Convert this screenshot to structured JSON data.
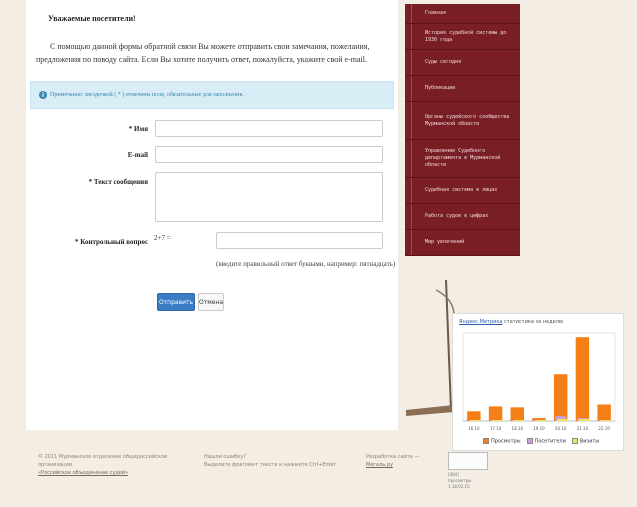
{
  "form": {
    "greeting": "Уважаемые посетители!",
    "intro": "С помощью данной формы обратной связи Вы можете отправить свои замечания, пожелания, предложения по поводу сайта. Если Вы хотите получить ответ, пожалуйста, укажите свой e-mail.",
    "note": "Примечание: звездочкой ( * ) отмечены поля, обязательные для заполнения.",
    "name_label": "* Имя",
    "email_label": "E-mail",
    "message_label": "* Текст сообщения",
    "captcha_label": "* Контрольный вопрос",
    "captcha_question": "2+7 =",
    "captcha_hint": "(введите правильный ответ буквами, например: пятнадцать)",
    "submit_label": "Отправить",
    "cancel_label": "Отмена"
  },
  "nav": {
    "items": [
      {
        "label": "Главная"
      },
      {
        "label": "История судебной системы до 1930 года"
      },
      {
        "label": "Суды сегодня"
      },
      {
        "label": "Публикации"
      },
      {
        "label": "Органы судейского сообщества Мурманской области"
      },
      {
        "label": "Управление Судебного департамента в Мурманской области"
      },
      {
        "label": "Судебная система в лицах"
      },
      {
        "label": "Работа судов в цифрах"
      },
      {
        "label": "Мир увлечений"
      }
    ]
  },
  "metrika": {
    "brand": "Яндекс.Метрика",
    "title_rest": "статистика за неделю",
    "legend": [
      "Просмотры",
      "Посетители",
      "Визиты"
    ]
  },
  "chart_data": {
    "type": "bar",
    "categories": [
      "16.10",
      "17.10",
      "18.10",
      "19.10",
      "20.10",
      "21.10",
      "22.10"
    ],
    "series": [
      {
        "name": "Просмотры",
        "values": [
          10,
          15,
          14,
          3,
          48,
          86,
          17
        ]
      },
      {
        "name": "Посетители",
        "values": [
          1,
          1,
          1,
          1,
          5,
          3,
          1
        ]
      },
      {
        "name": "Визиты",
        "values": [
          1,
          1,
          1,
          1,
          2,
          2,
          1
        ]
      }
    ],
    "colors": {
      "Просмотры": "#f57f17",
      "Посетители": "#c9a0dc",
      "Визиты": "#f2e45c"
    },
    "legend": "bottom"
  },
  "footer": {
    "col1_line1": "© 2011 Мурманское отделение общероссийской организации",
    "col1_link": "«Российское объединение судей»",
    "col2_line1": "Нашли ошибку?",
    "col2_line2": "Выделите фрагмент текста и нажмите Ctrl+Enter",
    "col3_line1": "Разработка сайта —",
    "col3_link": "Мегаль.ру",
    "counter_label": "",
    "counter_line1": "[404]",
    "counter_line2": "просмотры",
    "counter_line3": "1 18.02.15"
  }
}
